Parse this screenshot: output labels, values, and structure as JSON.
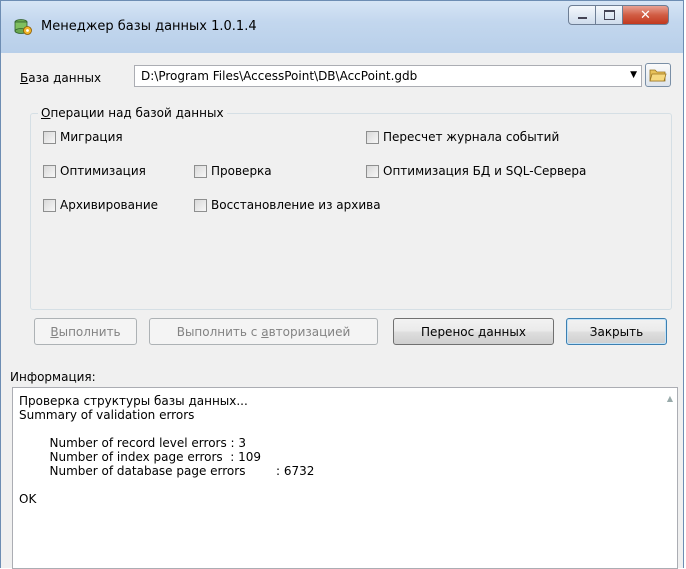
{
  "window": {
    "title": "Менеджер базы данных 1.0.1.4",
    "close_glyph": "✕"
  },
  "database": {
    "label_accel": "Б",
    "label_rest": "аза данных",
    "path": "D:\\Program Files\\AccessPoint\\DB\\AccPoint.gdb",
    "dropdown_glyph": "▼"
  },
  "operations": {
    "title_accel": "О",
    "title_rest": "перации над базой данных",
    "items": [
      {
        "label": "Миграция",
        "checked": false
      },
      {
        "label": "Пересчет журнала событий",
        "checked": false
      },
      {
        "label": "Оптимизация",
        "checked": false
      },
      {
        "label": "Проверка",
        "checked": false
      },
      {
        "label": "Оптимизация БД и SQL-Сервера",
        "checked": false
      },
      {
        "label": "Архивирование",
        "checked": false
      },
      {
        "label": "Восстановление из архива",
        "checked": false
      }
    ]
  },
  "buttons": {
    "execute_accel": "В",
    "execute_rest": "ыполнить",
    "execute_auth_pre": "Выполнить с ",
    "execute_auth_accel": "а",
    "execute_auth_rest": "вторизацией",
    "transfer": "Перенос данных",
    "close": "Закрыть"
  },
  "info": {
    "label": "Информация:",
    "text": "Проверка структуры базы данных...\nSummary of validation errors\n\n        Number of record level errors : 3\n        Number of index page errors  : 109\n        Number of database page errors        : 6732\n\nOK",
    "scroll_glyph": "▲"
  },
  "colors": {
    "titlebar": "#c3d7ee",
    "close_button": "#c2391f",
    "dialog_bg": "#f0f0f0"
  }
}
